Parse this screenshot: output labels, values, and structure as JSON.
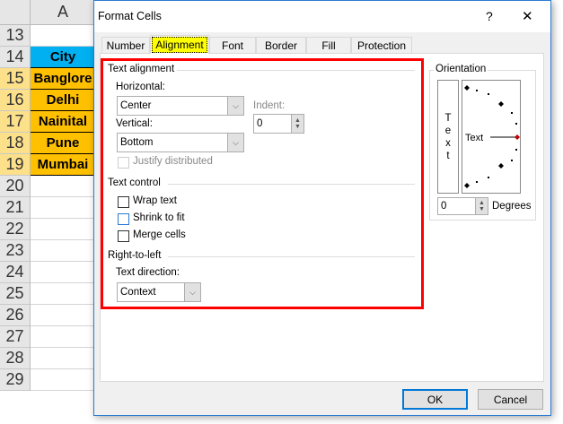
{
  "sheet": {
    "column": "A",
    "rows": [
      "13",
      "14",
      "15",
      "16",
      "17",
      "18",
      "19",
      "20",
      "21",
      "22",
      "23",
      "24",
      "25",
      "26",
      "27",
      "28",
      "29"
    ],
    "cells": [
      {
        "row": "14",
        "value": "City",
        "color": "#00b0f0"
      },
      {
        "row": "15",
        "value": "Banglore",
        "color": "#ffc000"
      },
      {
        "row": "16",
        "value": "Delhi",
        "color": "#ffc000"
      },
      {
        "row": "17",
        "value": "Nainital",
        "color": "#ffc000"
      },
      {
        "row": "18",
        "value": "Pune",
        "color": "#ffc000"
      },
      {
        "row": "19",
        "value": "Mumbai",
        "color": "#ffc000"
      }
    ]
  },
  "dialog": {
    "title": "Format Cells",
    "help": "?",
    "close": "✕",
    "tabs": [
      "Number",
      "Alignment",
      "Font",
      "Border",
      "Fill",
      "Protection"
    ],
    "active_tab": "Alignment",
    "text_alignment": {
      "heading": "Text alignment",
      "horizontal_label": "Horizontal:",
      "horizontal_value": "Center",
      "vertical_label": "Vertical:",
      "vertical_value": "Bottom",
      "indent_label": "Indent:",
      "indent_value": "0",
      "justify_label": "Justify distributed"
    },
    "text_control": {
      "heading": "Text control",
      "wrap": "Wrap text",
      "shrink": "Shrink to fit",
      "merge": "Merge cells"
    },
    "rtl": {
      "heading": "Right-to-left",
      "direction_label": "Text direction:",
      "direction_value": "Context"
    },
    "orientation": {
      "heading": "Orientation",
      "vertical_text": [
        "T",
        "e",
        "x",
        "t"
      ],
      "dial_text": "Text",
      "degrees_value": "0",
      "degrees_label": "Degrees"
    },
    "ok": "OK",
    "cancel": "Cancel",
    "highlight_color": "#ff0000"
  }
}
